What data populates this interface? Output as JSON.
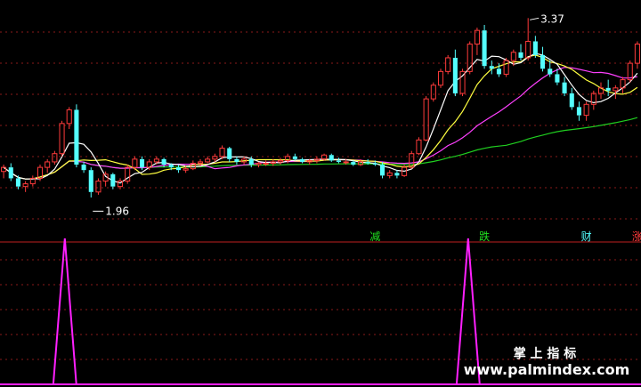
{
  "chart_data": [
    {
      "type": "candlestick",
      "ylim": [
        1.8,
        3.45
      ],
      "grid": true,
      "colors": {
        "up": "#ff3b3b",
        "down": "#54ffff",
        "ma_white": "#ffffff",
        "ma_yellow": "#ffff40",
        "ma_magenta": "#ff40ff",
        "ma_green": "#20d020",
        "grid": "#8a1a1a"
      },
      "high_label": "3.37",
      "high_value": 3.37,
      "high_index": 72,
      "low_label": "1.96",
      "low_value": 1.96,
      "low_index": 12,
      "candles": [
        [
          2.25,
          2.3,
          2.2,
          2.28
        ],
        [
          2.28,
          2.31,
          2.18,
          2.2
        ],
        [
          2.2,
          2.22,
          2.12,
          2.14
        ],
        [
          2.14,
          2.18,
          2.1,
          2.16
        ],
        [
          2.16,
          2.22,
          2.14,
          2.2
        ],
        [
          2.2,
          2.3,
          2.18,
          2.28
        ],
        [
          2.28,
          2.34,
          2.24,
          2.32
        ],
        [
          2.32,
          2.4,
          2.3,
          2.38
        ],
        [
          2.38,
          2.62,
          2.36,
          2.6
        ],
        [
          2.6,
          2.72,
          2.56,
          2.7
        ],
        [
          2.7,
          2.74,
          2.28,
          2.3
        ],
        [
          2.3,
          2.32,
          2.24,
          2.26
        ],
        [
          2.26,
          2.28,
          2.06,
          2.1
        ],
        [
          2.1,
          2.2,
          2.08,
          2.18
        ],
        [
          2.18,
          2.25,
          2.14,
          2.23
        ],
        [
          2.23,
          2.24,
          2.12,
          2.14
        ],
        [
          2.14,
          2.2,
          2.12,
          2.18
        ],
        [
          2.18,
          2.3,
          2.16,
          2.28
        ],
        [
          2.28,
          2.36,
          2.26,
          2.34
        ],
        [
          2.34,
          2.36,
          2.26,
          2.28
        ],
        [
          2.28,
          2.34,
          2.26,
          2.32
        ],
        [
          2.32,
          2.36,
          2.3,
          2.34
        ],
        [
          2.34,
          2.35,
          2.28,
          2.3
        ],
        [
          2.3,
          2.31,
          2.26,
          2.28
        ],
        [
          2.28,
          2.3,
          2.24,
          2.26
        ],
        [
          2.26,
          2.29,
          2.24,
          2.27
        ],
        [
          2.27,
          2.33,
          2.26,
          2.31
        ],
        [
          2.31,
          2.34,
          2.29,
          2.32
        ],
        [
          2.32,
          2.36,
          2.31,
          2.34
        ],
        [
          2.34,
          2.38,
          2.32,
          2.36
        ],
        [
          2.36,
          2.44,
          2.34,
          2.42
        ],
        [
          2.42,
          2.43,
          2.32,
          2.34
        ],
        [
          2.34,
          2.36,
          2.3,
          2.32
        ],
        [
          2.32,
          2.36,
          2.3,
          2.34
        ],
        [
          2.34,
          2.36,
          2.28,
          2.3
        ],
        [
          2.3,
          2.32,
          2.28,
          2.31
        ],
        [
          2.31,
          2.33,
          2.29,
          2.31
        ],
        [
          2.31,
          2.34,
          2.29,
          2.32
        ],
        [
          2.32,
          2.35,
          2.3,
          2.33
        ],
        [
          2.33,
          2.38,
          2.31,
          2.36
        ],
        [
          2.36,
          2.38,
          2.33,
          2.34
        ],
        [
          2.34,
          2.35,
          2.31,
          2.32
        ],
        [
          2.32,
          2.34,
          2.3,
          2.33
        ],
        [
          2.33,
          2.36,
          2.31,
          2.34
        ],
        [
          2.34,
          2.38,
          2.33,
          2.37
        ],
        [
          2.37,
          2.38,
          2.32,
          2.33
        ],
        [
          2.33,
          2.35,
          2.31,
          2.32
        ],
        [
          2.32,
          2.34,
          2.3,
          2.32
        ],
        [
          2.32,
          2.33,
          2.29,
          2.3
        ],
        [
          2.3,
          2.34,
          2.29,
          2.32
        ],
        [
          2.32,
          2.34,
          2.3,
          2.31
        ],
        [
          2.31,
          2.33,
          2.29,
          2.3
        ],
        [
          2.3,
          2.32,
          2.2,
          2.22
        ],
        [
          2.22,
          2.26,
          2.2,
          2.24
        ],
        [
          2.24,
          2.26,
          2.2,
          2.22
        ],
        [
          2.22,
          2.3,
          2.21,
          2.28
        ],
        [
          2.28,
          2.4,
          2.27,
          2.38
        ],
        [
          2.38,
          2.5,
          2.37,
          2.48
        ],
        [
          2.48,
          2.8,
          2.47,
          2.78
        ],
        [
          2.78,
          2.9,
          2.76,
          2.88
        ],
        [
          2.88,
          3.0,
          2.86,
          2.98
        ],
        [
          2.98,
          3.1,
          2.96,
          3.08
        ],
        [
          3.08,
          3.14,
          2.8,
          2.82
        ],
        [
          2.82,
          3.0,
          2.8,
          2.98
        ],
        [
          2.98,
          3.2,
          2.96,
          3.18
        ],
        [
          3.18,
          3.3,
          3.1,
          3.28
        ],
        [
          3.28,
          3.32,
          3.0,
          3.02
        ],
        [
          3.02,
          3.06,
          2.96,
          3.0
        ],
        [
          3.0,
          3.04,
          2.94,
          2.96
        ],
        [
          2.96,
          3.08,
          2.94,
          3.06
        ],
        [
          3.06,
          3.14,
          3.02,
          3.12
        ],
        [
          3.12,
          3.18,
          3.06,
          3.08
        ],
        [
          3.08,
          3.37,
          3.06,
          3.2
        ],
        [
          3.2,
          3.24,
          3.08,
          3.1
        ],
        [
          3.1,
          3.16,
          2.98,
          3.0
        ],
        [
          3.0,
          3.06,
          2.94,
          2.96
        ],
        [
          2.96,
          3.0,
          2.88,
          2.9
        ],
        [
          2.9,
          2.94,
          2.8,
          2.82
        ],
        [
          2.82,
          2.86,
          2.7,
          2.72
        ],
        [
          2.72,
          2.76,
          2.62,
          2.66
        ],
        [
          2.66,
          2.76,
          2.62,
          2.74
        ],
        [
          2.74,
          2.84,
          2.7,
          2.82
        ],
        [
          2.82,
          2.9,
          2.78,
          2.86
        ],
        [
          2.86,
          2.92,
          2.8,
          2.84
        ],
        [
          2.84,
          2.88,
          2.78,
          2.86
        ],
        [
          2.86,
          2.94,
          2.82,
          2.92
        ],
        [
          2.92,
          3.06,
          2.9,
          3.04
        ],
        [
          3.04,
          3.2,
          3.0,
          3.18
        ]
      ]
    },
    {
      "type": "line",
      "ylim": [
        0,
        1
      ],
      "grid": true,
      "line_color": "#ff20ff",
      "values": [
        0,
        0,
        0,
        0,
        0,
        0,
        0,
        0,
        0,
        0,
        0,
        0,
        0,
        0,
        0,
        0,
        0,
        0,
        0,
        0,
        0,
        0,
        0,
        0,
        0,
        0,
        0,
        0,
        0,
        0,
        0,
        0,
        0,
        0,
        0,
        0,
        0,
        0,
        0,
        0,
        0,
        0,
        0,
        0,
        0,
        0,
        0,
        0,
        0,
        0,
        0,
        0,
        0,
        0,
        0,
        0,
        0,
        0,
        0,
        0,
        0,
        0,
        0,
        0,
        0,
        0,
        0,
        0,
        0,
        0,
        0,
        0,
        0,
        0,
        0,
        0,
        0,
        0,
        0,
        0,
        0,
        0,
        0,
        0,
        0,
        0,
        0,
        0,
        0
      ],
      "spikes": [
        {
          "x": 8,
          "value": 1
        },
        {
          "x": 64,
          "value": 1
        }
      ]
    }
  ],
  "signals": [
    {
      "text": "减",
      "color": "#20e020",
      "index": 51
    },
    {
      "text": "跌",
      "color": "#20e020",
      "index": 66
    },
    {
      "text": "财",
      "color": "#54ffff",
      "index": 80
    },
    {
      "text": "涨",
      "color": "#ff3b3b",
      "index": 87
    }
  ],
  "watermark": {
    "line1": "掌 上 指 标",
    "line2": "www.palmindex.com"
  }
}
